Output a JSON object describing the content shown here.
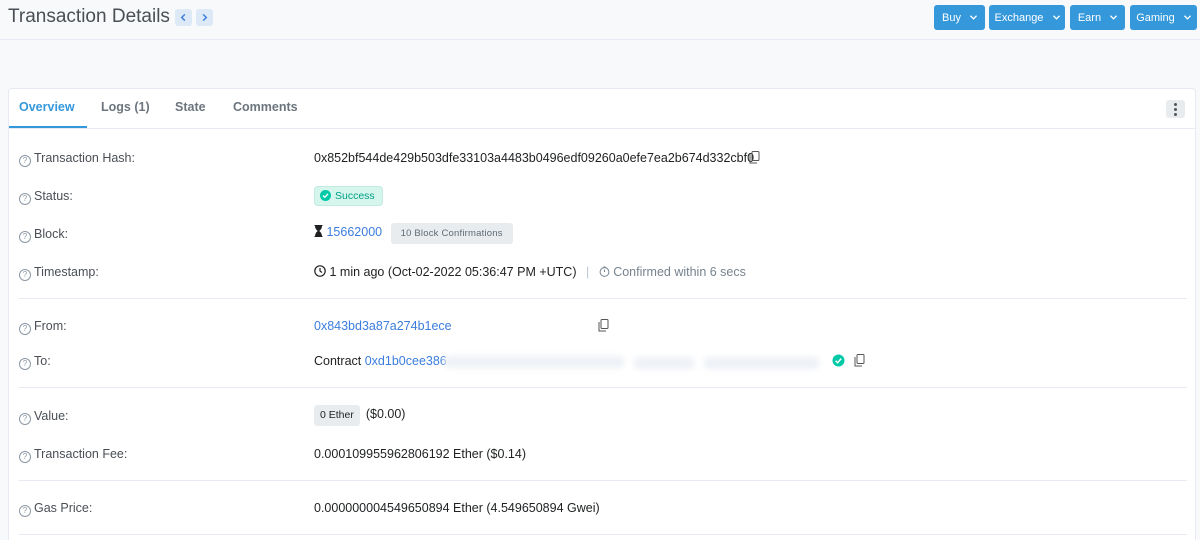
{
  "header": {
    "title": "Transaction Details",
    "buttons": [
      {
        "label": "Buy"
      },
      {
        "label": "Exchange"
      },
      {
        "label": "Earn"
      },
      {
        "label": "Gaming"
      }
    ]
  },
  "tabs": [
    {
      "label": "Overview",
      "active": true
    },
    {
      "label": "Logs (1)"
    },
    {
      "label": "State"
    },
    {
      "label": "Comments"
    }
  ],
  "details": {
    "tx_hash": {
      "label": "Transaction Hash:",
      "value": "0x852bf544de429b503dfe33103a4483b0496edf09260a0efe7ea2b674d332cbf0"
    },
    "status": {
      "label": "Status:",
      "value": "Success"
    },
    "block": {
      "label": "Block:",
      "value": "15662000",
      "confirmations": "10 Block Confirmations"
    },
    "timestamp": {
      "label": "Timestamp:",
      "value": "1 min ago (Oct-02-2022 05:36:47 PM +UTC)",
      "confirmed": "Confirmed within 6 secs"
    },
    "from": {
      "label": "From:",
      "value": "0x843bd3a87a274b1ece"
    },
    "to": {
      "label": "To:",
      "prefix": "Contract",
      "value": "0xd1b0cee386"
    },
    "value": {
      "label": "Value:",
      "badge": "0 Ether",
      "usd": "($0.00)"
    },
    "fee": {
      "label": "Transaction Fee:",
      "value": "0.000109955962806192 Ether ($0.14)"
    },
    "gas_price": {
      "label": "Gas Price:",
      "value": "0.000000004549650894 Ether (4.549650894 Gwei)"
    }
  },
  "colors": {
    "accent": "#3498db",
    "success": "#00c9a7",
    "link": "#3b7ddd"
  }
}
